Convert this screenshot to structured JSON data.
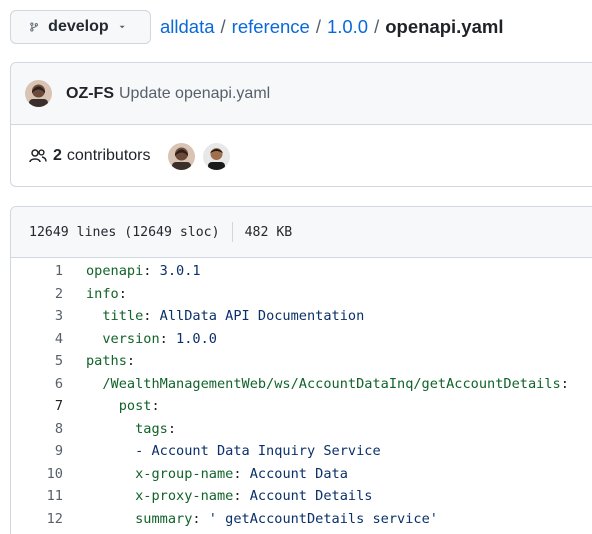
{
  "branch": {
    "name": "develop",
    "icon": "git-branch-icon"
  },
  "breadcrumb": {
    "repo": "alldata",
    "dir1": "reference",
    "dir2": "1.0.0",
    "file": "openapi.yaml",
    "separator": "/"
  },
  "commit": {
    "author": "OZ-FS",
    "message": "Update openapi.yaml"
  },
  "contributors": {
    "count": "2",
    "label": "contributors"
  },
  "file_info": {
    "lines": "12649 lines (12649 sloc)",
    "size": "482 KB"
  },
  "code_lines": [
    {
      "num": "1",
      "indent": "",
      "key": "openapi",
      "sep": ": ",
      "value": "3.0.1"
    },
    {
      "num": "2",
      "indent": "",
      "key": "info",
      "sep": ":",
      "value": ""
    },
    {
      "num": "3",
      "indent": "  ",
      "key": "title",
      "sep": ": ",
      "value": "AllData API Documentation"
    },
    {
      "num": "4",
      "indent": "  ",
      "key": "version",
      "sep": ": ",
      "value": "1.0.0"
    },
    {
      "num": "5",
      "indent": "",
      "key": "paths",
      "sep": ":",
      "value": ""
    },
    {
      "num": "6",
      "indent": "  ",
      "key": "/WealthManagementWeb/ws/AccountDataInq/getAccountDetails",
      "sep": ":",
      "value": ""
    },
    {
      "num": "7",
      "indent": "    ",
      "key": "post",
      "sep": ":",
      "value": ""
    },
    {
      "num": "8",
      "indent": "      ",
      "key": "tags",
      "sep": ":",
      "value": ""
    },
    {
      "num": "9",
      "indent": "      ",
      "key": "",
      "sep": "",
      "value": "- Account Data Inquiry Service"
    },
    {
      "num": "10",
      "indent": "      ",
      "key": "x-group-name",
      "sep": ": ",
      "value": "Account Data"
    },
    {
      "num": "11",
      "indent": "      ",
      "key": "x-proxy-name",
      "sep": ": ",
      "value": "Account Details"
    },
    {
      "num": "12",
      "indent": "      ",
      "key": "summary",
      "sep": ": ",
      "value": "' getAccountDetails service'"
    }
  ],
  "colors": {
    "link": "#0969da",
    "yaml_key": "#116329",
    "yaml_value": "#0a3069"
  }
}
